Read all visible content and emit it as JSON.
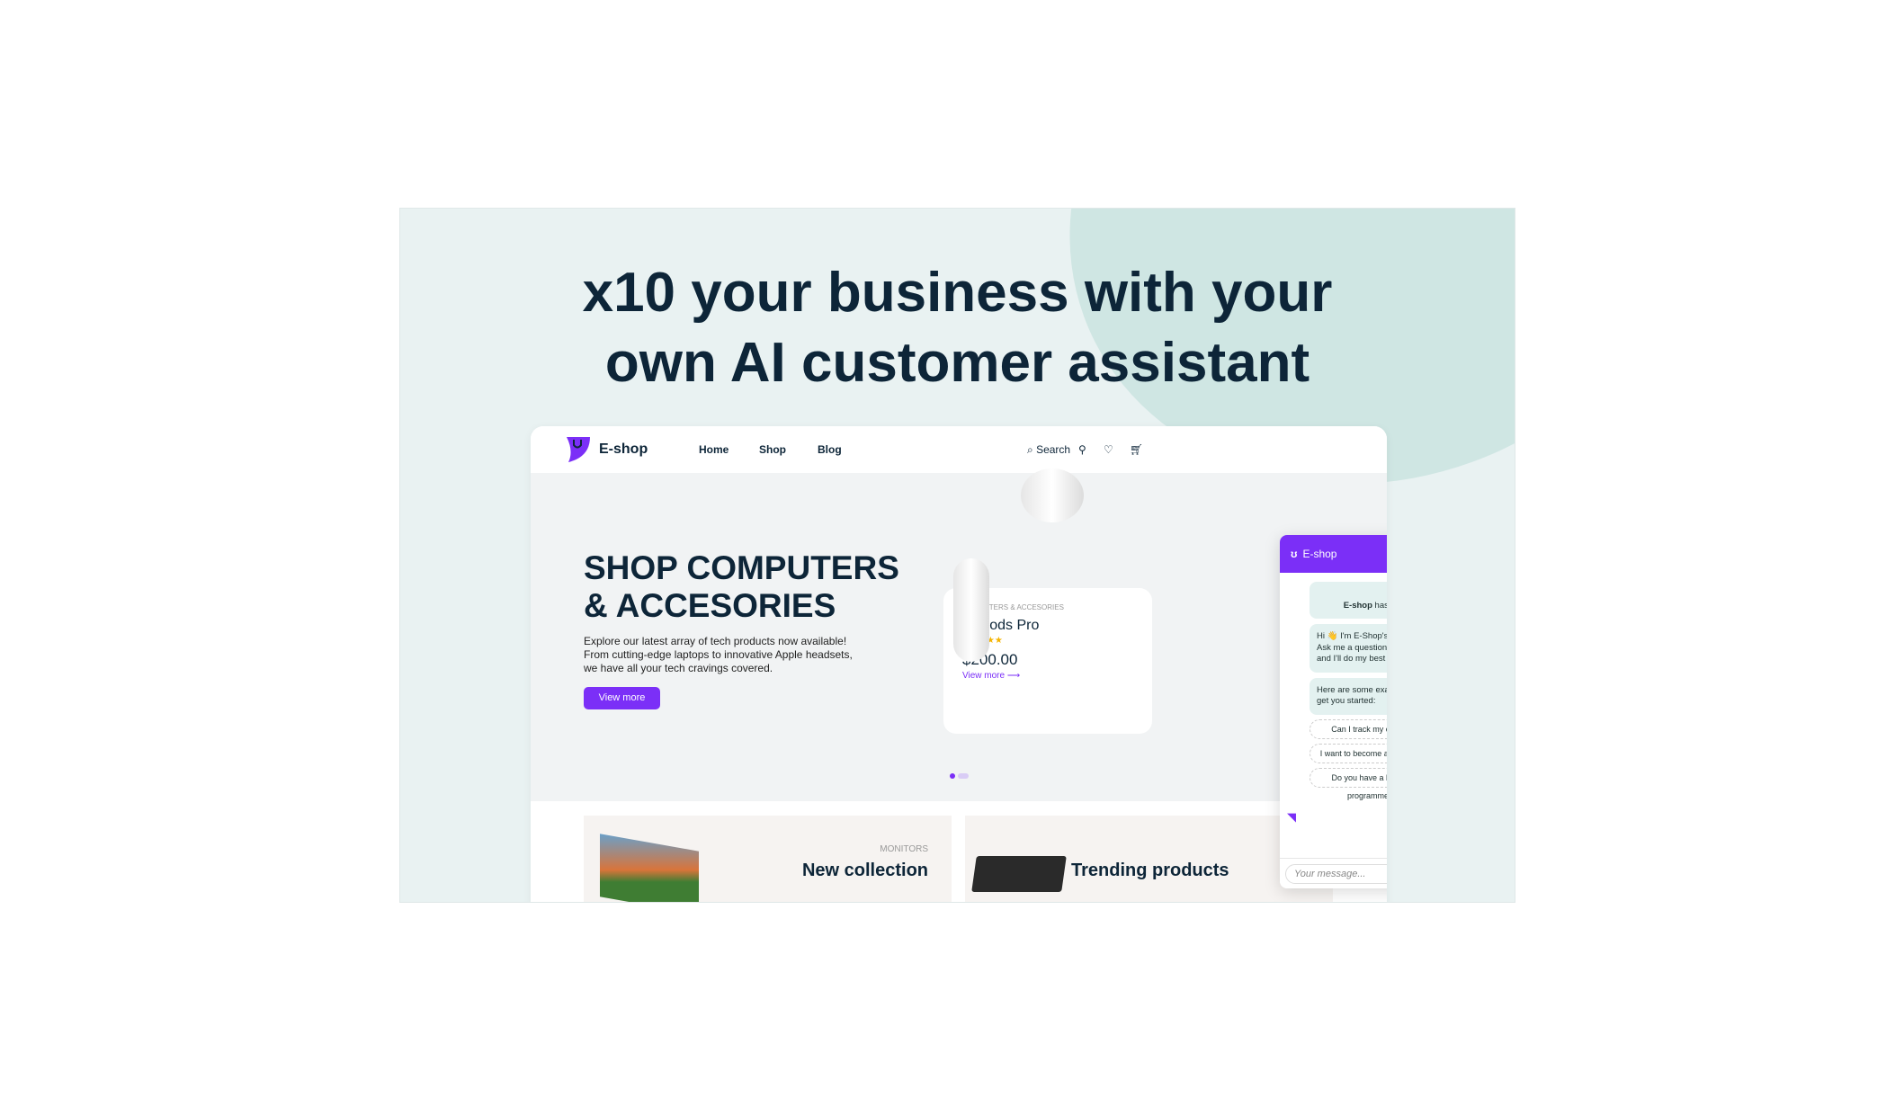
{
  "headline": {
    "line1": "x10 your business with your",
    "line2": "own AI customer assistant"
  },
  "nav": {
    "brand": "E-shop",
    "links": [
      "Home",
      "Shop",
      "Blog"
    ],
    "search": "Search"
  },
  "hero": {
    "title": "SHOP COMPUTERS & ACCESORIES",
    "description": "Explore our latest array of tech products now available! From cutting-edge laptops to innovative Apple headsets, we have all your tech cravings covered.",
    "cta": "View more"
  },
  "product": {
    "category": "COMPUTERS & ACCESORIES",
    "name": "AirPods Pro",
    "rating": 5,
    "price": "$200.00",
    "link": "View more"
  },
  "carousel": {
    "active": 1,
    "total": 2
  },
  "sections": [
    {
      "category": "MONITORS",
      "title": "New collection"
    },
    {
      "title": "Trending products"
    }
  ],
  "chat": {
    "title": "E-shop",
    "joined_bold": "E-shop",
    "joined_rest": " has joined the chat",
    "greeting": "Hi 👋 I'm E-Shop's very own AI assistant. Ask me a question about our products and I'll do my best to help.",
    "examples_intro": "Here are some examples to get you started:",
    "suggestions": [
      "Can I track my order?",
      "I want to become a member",
      "Do you have a loyalty programme?"
    ],
    "placeholder": "Your message..."
  },
  "colors": {
    "accent": "#7b2ff7",
    "dark": "#0d2538",
    "bubble": "#e3f1f0"
  }
}
